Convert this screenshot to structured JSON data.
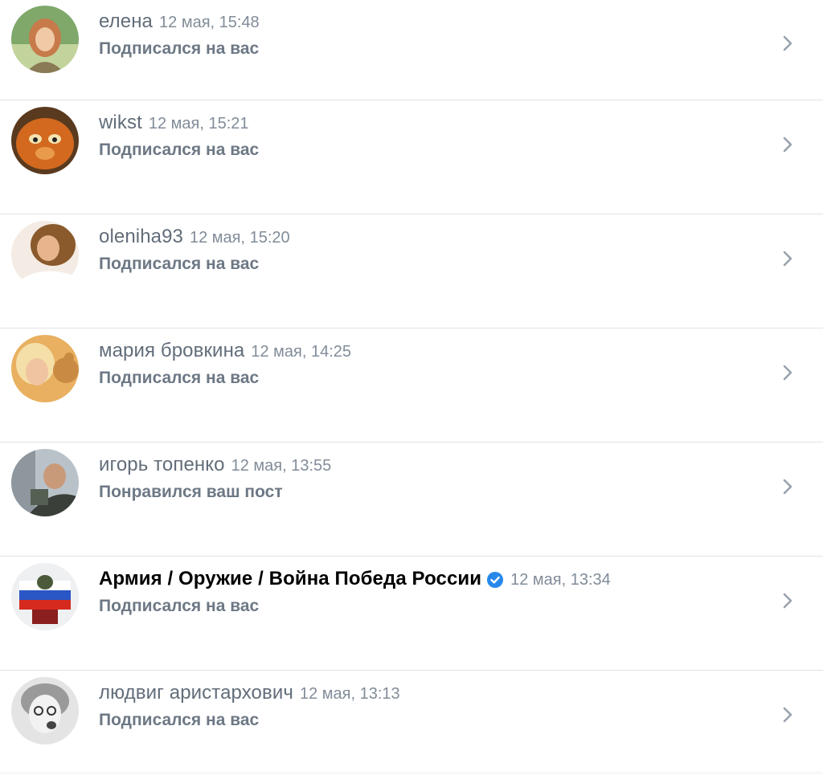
{
  "notifications": [
    {
      "name": "елена",
      "time": "12 мая, 15:48",
      "action": "Подписался на вас",
      "verified": false,
      "avatar_colors": [
        "#9dbf7a",
        "#c9a46c"
      ]
    },
    {
      "name": "wikst",
      "time": "12 мая, 15:21",
      "action": "Подписался на вас",
      "verified": false,
      "avatar_colors": [
        "#d2691e",
        "#8b3e12"
      ]
    },
    {
      "name": "oleniha93",
      "time": "12 мая, 15:20",
      "action": "Подписался на вас",
      "verified": false,
      "avatar_colors": [
        "#e8c8a8",
        "#a0643c"
      ]
    },
    {
      "name": "мария бровкина",
      "time": "12 мая, 14:25",
      "action": "Подписался на вас",
      "verified": false,
      "avatar_colors": [
        "#f2d6a0",
        "#d9a35c"
      ]
    },
    {
      "name": "игорь топенко",
      "time": "12 мая, 13:55",
      "action": "Понравился ваш пост",
      "verified": false,
      "avatar_colors": [
        "#8e9aa4",
        "#3b4148"
      ]
    },
    {
      "name": "Армия / Оружие / Война Победа России",
      "time": "12 мая, 13:34",
      "action": "Подписался на вас",
      "verified": true,
      "avatar_colors": [
        "#e9ecef",
        "#c0392b"
      ]
    },
    {
      "name": "людвиг аристархович",
      "time": "12 мая, 13:13",
      "action": "Подписался на вас",
      "verified": false,
      "avatar_colors": [
        "#d8d8d8",
        "#555555"
      ]
    }
  ],
  "icons": {
    "chevron": "chevron-right-icon",
    "verified": "verified-check-icon"
  },
  "colors": {
    "name": "#626d7a",
    "time": "#818c99",
    "action": "#6d7885",
    "verified": "#2688eb",
    "chevron": "#99a2ad"
  }
}
